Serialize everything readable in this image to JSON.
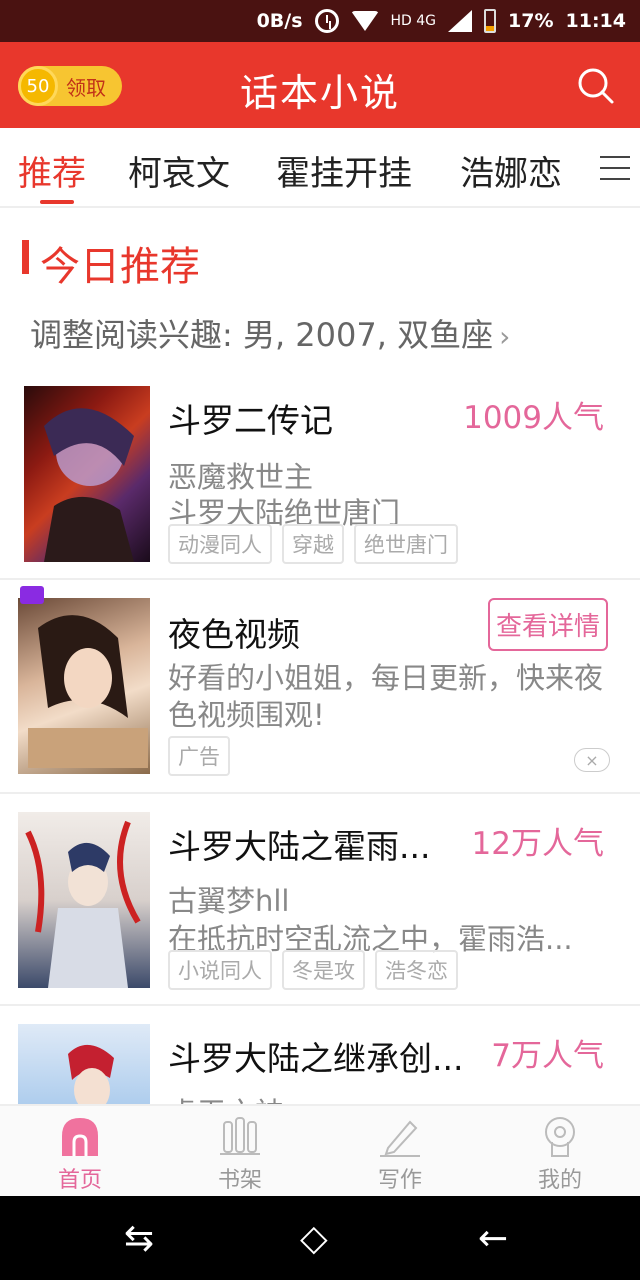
{
  "status_bar": {
    "net_speed": "0B/s",
    "network": "HD 4G",
    "battery": "17%",
    "time": "11:14"
  },
  "header": {
    "coin_count": "50",
    "coin_label": "领取",
    "title": "话本小说",
    "search_icon": "search-icon"
  },
  "tabs": [
    {
      "label": "推荐"
    },
    {
      "label": "柯哀文"
    },
    {
      "label": "霍挂开挂"
    },
    {
      "label": "浩娜恋"
    }
  ],
  "section": {
    "title": "今日推荐",
    "interest_text": "调整阅读兴趣: 男, 2007, 双鱼座",
    "chevron": "›"
  },
  "books": [
    {
      "title": "斗罗二传记",
      "popularity": "1009人气",
      "author": "恶魔救世主",
      "desc": "斗罗大陆绝世唐门",
      "tags": [
        "动漫同人",
        "穿越",
        "绝世唐门"
      ]
    },
    {
      "title": "夜色视频",
      "button": "查看详情",
      "desc": "好看的小姐姐，每日更新，快来夜色视频围观!",
      "tags": [
        "广告"
      ],
      "close": "×"
    },
    {
      "title": "斗罗大陆之霍雨...",
      "popularity": "12万人气",
      "author": "古翼梦hll",
      "desc": "在抵抗时空乱流之中，霍雨浩...",
      "tags": [
        "小说同人",
        "冬是攻",
        "浩冬恋"
      ]
    },
    {
      "title": "斗罗大陆之继承创...",
      "popularity": "7万人气",
      "author": "虚无之神"
    }
  ],
  "bottom_nav": [
    {
      "label": "首页",
      "icon": "home-icon"
    },
    {
      "label": "书架",
      "icon": "bookshelf-icon"
    },
    {
      "label": "写作",
      "icon": "pen-icon"
    },
    {
      "label": "我的",
      "icon": "profile-icon"
    }
  ],
  "system_nav": {
    "recent": "⇆",
    "home": "◇",
    "back": "←"
  },
  "colors": {
    "brand_red": "#e8372c",
    "accent_pink": "#e4679a",
    "coin_yellow": "#f7c531"
  }
}
